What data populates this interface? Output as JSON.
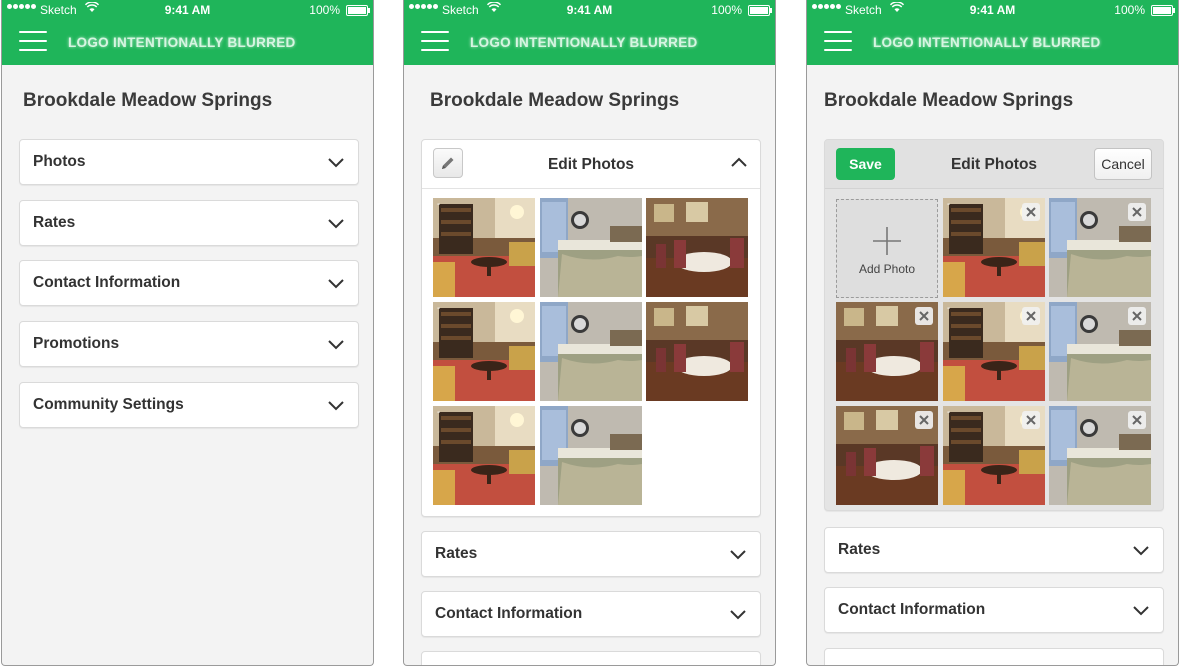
{
  "status": {
    "carrier": "Sketch",
    "time": "9:41 AM",
    "battery": "100%"
  },
  "logo": "LOGO INTENTIONALLY BLURRED",
  "page_title": "Brookdale Meadow Springs",
  "sections": {
    "photos": "Photos",
    "rates": "Rates",
    "contact": "Contact Information",
    "promotions": "Promotions",
    "settings": "Community Settings"
  },
  "edit": {
    "title": "Edit Photos",
    "save": "Save",
    "cancel": "Cancel",
    "add_photo": "Add Photo"
  },
  "photo_kinds": [
    "living-room",
    "bedroom",
    "dining-room",
    "living-room",
    "bedroom",
    "dining-room",
    "living-room",
    "bedroom"
  ],
  "colors": {
    "brand": "#1fb55a"
  }
}
